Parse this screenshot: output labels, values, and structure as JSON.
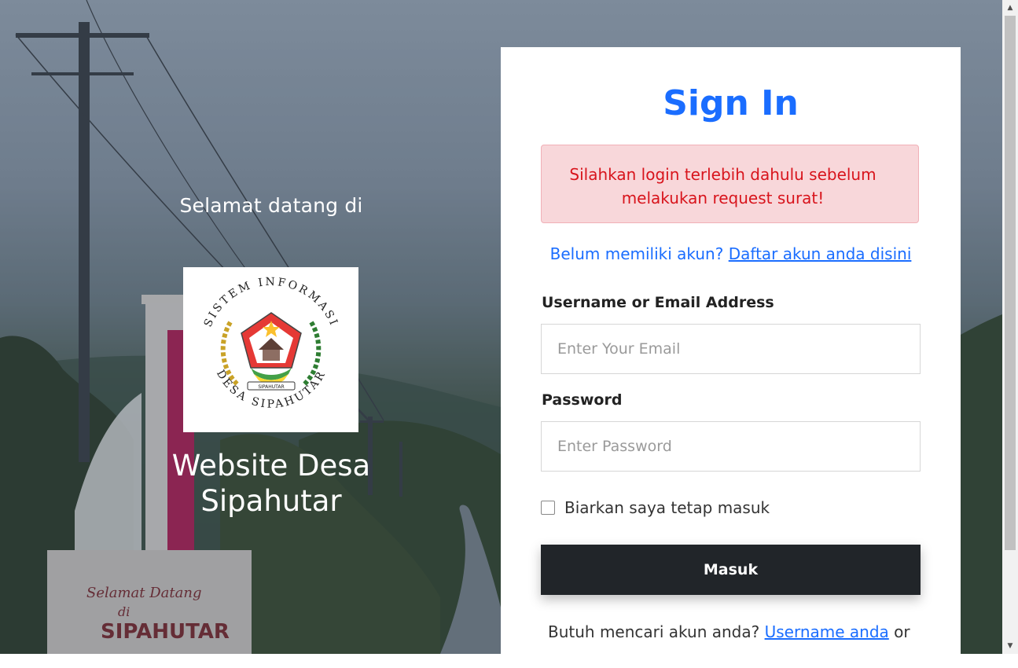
{
  "hero": {
    "welcome": "Selamat datang di",
    "logo_top_text": "SISTEM INFORMASI",
    "logo_bottom_text": "DESA SIPAHUTAR",
    "logo_ribbon": "SIPAHUTAR",
    "site_title": "Website Desa Sipahutar",
    "gate_text_line1": "Selamat Datang",
    "gate_text_line2": "di",
    "gate_text_line3": "SIPAHUTAR"
  },
  "login": {
    "title": "Sign In",
    "alert": "Silahkan login terlebih dahulu sebelum melakukan request surat!",
    "register_prompt": "Belum memiliki akun?",
    "register_link": "Daftar akun anda disini",
    "username_label": "Username or Email Address",
    "username_placeholder": "Enter Your Email",
    "password_label": "Password",
    "password_placeholder": "Enter Password",
    "remember_label": "Biarkan saya tetap masuk",
    "submit_label": "Masuk",
    "find_prompt": "Butuh mencari akun anda?",
    "find_link": "Username anda",
    "find_suffix": "or"
  },
  "colors": {
    "accent": "#1a6dff",
    "alert_bg": "#f8d7da",
    "alert_text": "#d8141c",
    "button_bg": "#212529"
  },
  "icons": {
    "scroll_up": "triangle-up",
    "scroll_down": "triangle-down"
  }
}
